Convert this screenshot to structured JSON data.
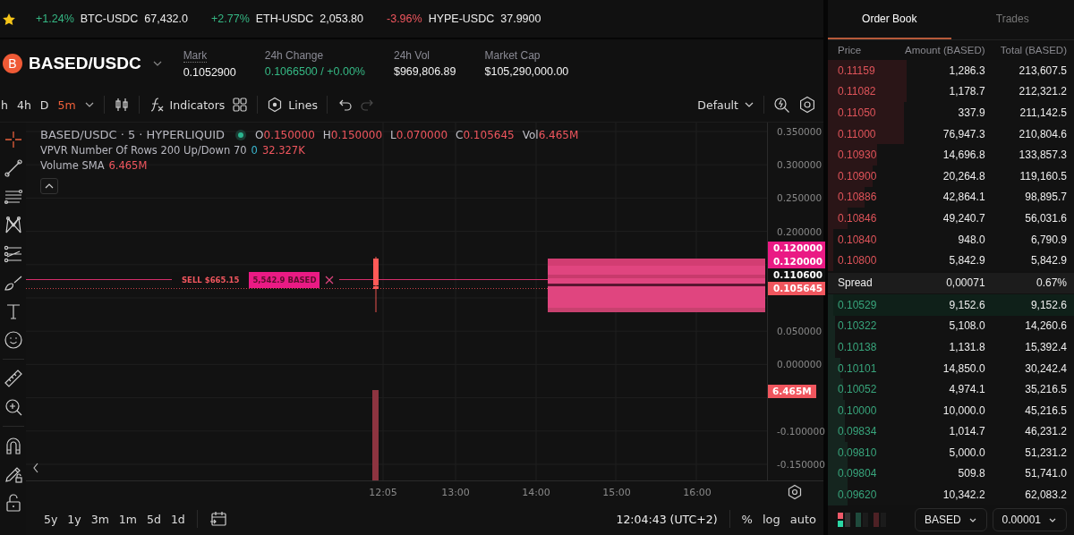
{
  "ticker": {
    "favorite": true,
    "items": [
      {
        "change": "+1.24%",
        "color": "#35b884",
        "symbol": "BTC-USDC",
        "price": "67,432.0"
      },
      {
        "change": "+2.77%",
        "color": "#35b884",
        "symbol": "ETH-USDC",
        "price": "2,053.80"
      },
      {
        "change": "-3.96%",
        "color": "#f0565e",
        "symbol": "HYPE-USDC",
        "price": "37.9900"
      }
    ]
  },
  "market": {
    "logo_letter": "B",
    "pair": "BASED/USDC",
    "stats": [
      {
        "label": "Mark",
        "value": "0.1052900",
        "underlined": true,
        "color": "#f2f2f2"
      },
      {
        "label": "24h Change",
        "value": "0.1066500 / +0.00%",
        "underlined": false,
        "color": "#35b884"
      },
      {
        "label": "24h Vol",
        "value": "$969,806.89",
        "underlined": false,
        "color": "#f2f2f2"
      },
      {
        "label": "Market Cap",
        "value": "$105,290,000.00",
        "underlined": false,
        "color": "#f2f2f2"
      }
    ]
  },
  "toolbar": {
    "intervals": [
      {
        "label": "h",
        "selected": false
      },
      {
        "label": "4h",
        "selected": false
      },
      {
        "label": "D",
        "selected": false
      },
      {
        "label": "5m",
        "selected": true
      }
    ],
    "indicators_label": "Indicators",
    "chart_type_label": "Lines",
    "layout_label": "Default",
    "undo_disabled": false,
    "redo_disabled": true
  },
  "chart": {
    "legend": {
      "title": "BASED/USDC · 5 · HYPERLIQUID",
      "ohlc": [
        {
          "key": "O",
          "value": "0.150000"
        },
        {
          "key": "H",
          "value": "0.150000"
        },
        {
          "key": "L",
          "value": "0.070000"
        },
        {
          "key": "C",
          "value": "0.105645"
        },
        {
          "key": "Vol",
          "value": "6.465M"
        }
      ],
      "vpvr_label": "VPVR Number Of Rows 200 Up/Down 70",
      "vpvr_up": "0",
      "vpvr_down": "32.327K",
      "sma_label": "Volume SMA",
      "sma_value": "6.465M"
    },
    "order_line": {
      "kind": "sell",
      "label": "SELL $665.15",
      "size": "5,542.9 BASED"
    },
    "price_axis": {
      "upper": [
        "0.350000",
        "0.300000",
        "0.250000",
        "0.200000"
      ],
      "middle": [
        "0.050000",
        "0.000000"
      ],
      "lower": [
        "-0.100000",
        "-0.150000"
      ]
    },
    "price_badges": [
      {
        "text": "0.120000",
        "kind": "order"
      },
      {
        "text": "0.120000",
        "kind": "order"
      },
      {
        "text": "0.110600",
        "kind": "last"
      },
      {
        "text": "0.105645",
        "kind": "price"
      }
    ],
    "volume_badge": "6.465M",
    "time_axis": [
      "12:05",
      "13:00",
      "14:00",
      "15:00",
      "16:00"
    ]
  },
  "bottom_bar": {
    "ranges": [
      "5y",
      "1y",
      "3m",
      "1m",
      "5d",
      "1d"
    ],
    "clock": "12:04:43 (UTC+2)",
    "scale_options": [
      "%",
      "log",
      "auto"
    ]
  },
  "order_book": {
    "tabs": [
      {
        "label": "Order Book",
        "selected": true
      },
      {
        "label": "Trades",
        "selected": false
      }
    ],
    "columns": [
      "Price",
      "Amount (BASED)",
      "Total (BASED)"
    ],
    "asks": [
      {
        "price": "0.11159",
        "amount": "1,286.3",
        "total": "213,607.5",
        "level": 0.32
      },
      {
        "price": "0.11082",
        "amount": "1,178.7",
        "total": "212,321.2",
        "level": 0.32
      },
      {
        "price": "0.11050",
        "amount": "337.9",
        "total": "211,142.5",
        "level": 0.31
      },
      {
        "price": "0.11000",
        "amount": "76,947.3",
        "total": "210,804.6",
        "level": 0.31
      },
      {
        "price": "0.10930",
        "amount": "14,696.8",
        "total": "133,857.3",
        "level": 0.2
      },
      {
        "price": "0.10900",
        "amount": "20,264.8",
        "total": "119,160.5",
        "level": 0.18
      },
      {
        "price": "0.10886",
        "amount": "42,864.1",
        "total": "98,895.7",
        "level": 0.15
      },
      {
        "price": "0.10846",
        "amount": "49,240.7",
        "total": "56,031.6",
        "level": 0.08
      },
      {
        "price": "0.10840",
        "amount": "948.0",
        "total": "6,790.9",
        "level": 0.02
      },
      {
        "price": "0.10800",
        "amount": "5,842.9",
        "total": "5,842.9",
        "level": 0.02
      }
    ],
    "spread": {
      "label": "Spread",
      "value": "0,00071",
      "percent": "0.67%"
    },
    "bids": [
      {
        "price": "0.10529",
        "amount": "9,152.6",
        "total": "9,152.6",
        "level": 0.02,
        "highlighted": true
      },
      {
        "price": "0.10322",
        "amount": "5,108.0",
        "total": "14,260.6",
        "level": 0.03,
        "highlighted": false
      },
      {
        "price": "0.10138",
        "amount": "1,131.8",
        "total": "15,392.4",
        "level": 0.03,
        "highlighted": false
      },
      {
        "price": "0.10101",
        "amount": "14,850.0",
        "total": "30,242.4",
        "level": 0.05,
        "highlighted": false
      },
      {
        "price": "0.10052",
        "amount": "4,974.1",
        "total": "35,216.5",
        "level": 0.06,
        "highlighted": false
      },
      {
        "price": "0.10000",
        "amount": "10,000.0",
        "total": "45,216.5",
        "level": 0.07,
        "highlighted": false
      },
      {
        "price": "0.09834",
        "amount": "1,014.7",
        "total": "46,231.2",
        "level": 0.07,
        "highlighted": false
      },
      {
        "price": "0.09810",
        "amount": "5,000.0",
        "total": "51,231.2",
        "level": 0.08,
        "highlighted": false
      },
      {
        "price": "0.09804",
        "amount": "509.8",
        "total": "51,741.0",
        "level": 0.08,
        "highlighted": false
      },
      {
        "price": "0.09620",
        "amount": "10,342.2",
        "total": "62,083.2",
        "level": 0.08,
        "highlighted": false
      }
    ],
    "footer": {
      "symbol": "BASED",
      "tick": "0.00001"
    }
  }
}
